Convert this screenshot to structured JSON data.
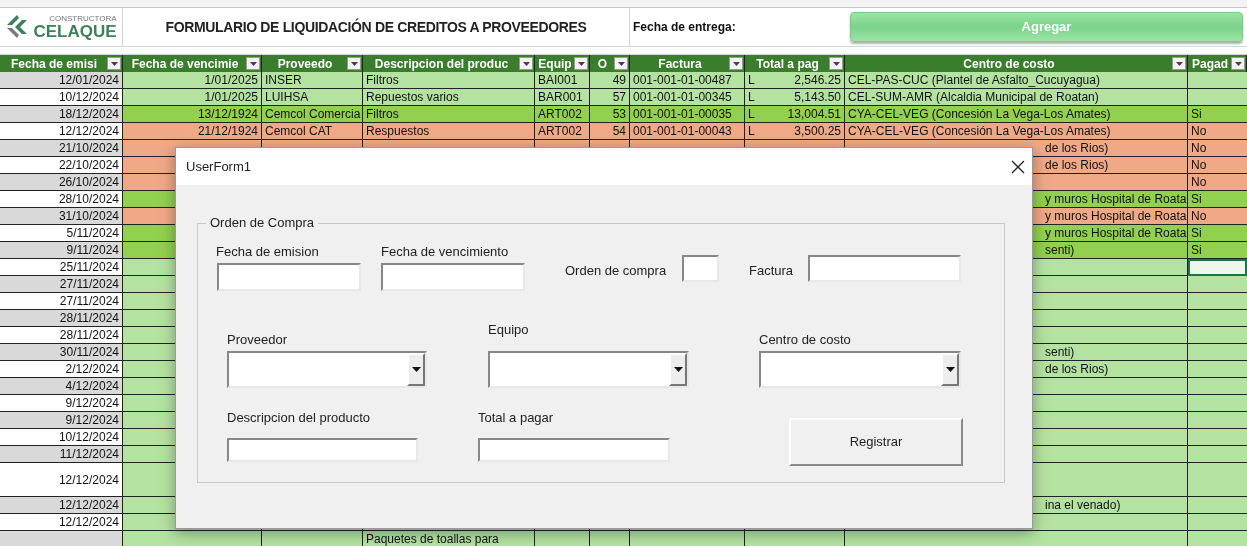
{
  "sheet": {
    "logo": {
      "tagline": "CONSTRUCTORA",
      "name": "CELAQUE"
    },
    "title": "FORMULARIO DE LIQUIDACIÓN DE CREDITOS A PROVEEDORES",
    "delivery_label": "Fecha de entrega:",
    "add_button": "Agregar",
    "columns": [
      "Fecha de emisi",
      "Fecha de vencimie",
      "Proveedo",
      "Descripcion del produc",
      "Equip",
      "O",
      "Factura",
      "Total a pag",
      "Centro de costo",
      "Pagad"
    ],
    "rows": [
      {
        "color": "#b4e3a1",
        "selected": false,
        "currency": "L",
        "cells": [
          "12/01/2024",
          "1/01/2025",
          "INSER",
          "Filtros",
          "BAI001",
          "49",
          "001-001-01-00487",
          "2,546.25",
          "CEL-PAS-CUC (Plantel de Asfalto_Cucuyagua)",
          null
        ]
      },
      {
        "color": "#b4e3a1",
        "selected": false,
        "currency": "L",
        "cells": [
          "10/12/2024",
          "1/01/2025",
          "LUIHSA",
          "Repuestos varios",
          "BAR001",
          "57",
          "001-001-01-00345",
          "5,143.50",
          "CEL-SUM-AMR (Alcaldia Municipal de Roatan)",
          null
        ]
      },
      {
        "color": "#92d050",
        "selected": false,
        "currency": "L",
        "cells": [
          "18/12/2024",
          "13/12/1924",
          "Cemcol Comercia",
          "Filtros",
          "ART002",
          "53",
          "001-001-01-00035",
          "13,004.51",
          "CYA-CEL-VEG (Concesión La Vega-Los Amates)",
          "Si"
        ]
      },
      {
        "color": "#f0a986",
        "selected": false,
        "currency": "L",
        "cells": [
          "12/12/2024",
          "21/12/1924",
          "Cemcol CAT",
          "Respuestos",
          "ART002",
          "54",
          "001-001-01-00043",
          "3,500.25",
          "CYA-CEL-VEG (Concesión La Vega-Los Amates)",
          "No"
        ]
      },
      {
        "color": "#f0a986",
        "selected": false,
        "cells": [
          "21/10/2024",
          null,
          null,
          null,
          null,
          null,
          null,
          null,
          "de los Rios)",
          "No"
        ]
      },
      {
        "color": "#f0a986",
        "selected": false,
        "cells": [
          "22/10/2024",
          null,
          null,
          null,
          null,
          null,
          null,
          null,
          "de los Rios)",
          "No"
        ]
      },
      {
        "color": "#f0a986",
        "selected": false,
        "cells": [
          "26/10/2024",
          null,
          null,
          null,
          null,
          null,
          null,
          null,
          null,
          "No"
        ]
      },
      {
        "color": "#92d050",
        "selected": false,
        "cells": [
          "28/10/2024",
          null,
          null,
          null,
          null,
          null,
          null,
          null,
          "y muros Hospital de Roata",
          "Si"
        ]
      },
      {
        "color": "#f0a986",
        "selected": false,
        "cells": [
          "31/10/2024",
          null,
          null,
          null,
          null,
          null,
          null,
          null,
          "y muros Hospital de Roata",
          "No"
        ]
      },
      {
        "color": "#92d050",
        "selected": false,
        "cells": [
          "5/11/2024",
          null,
          null,
          null,
          null,
          null,
          null,
          null,
          "y muros Hospital de Roata",
          "Si"
        ]
      },
      {
        "color": "#92d050",
        "selected": false,
        "cells": [
          "9/11/2024",
          null,
          null,
          null,
          null,
          null,
          null,
          null,
          "senti)",
          "Si"
        ]
      },
      {
        "color": "#b4e3a1",
        "selected": true,
        "cells": [
          "25/11/2024",
          null,
          null,
          null,
          null,
          null,
          null,
          null,
          null,
          null
        ]
      },
      {
        "color": "#b4e3a1",
        "selected": false,
        "cells": [
          "27/11/2024",
          null,
          null,
          null,
          null,
          null,
          null,
          null,
          null,
          null
        ]
      },
      {
        "color": "#b4e3a1",
        "selected": false,
        "cells": [
          "27/11/2024",
          null,
          null,
          null,
          null,
          null,
          null,
          null,
          null,
          null
        ]
      },
      {
        "color": "#b4e3a1",
        "selected": false,
        "cells": [
          "28/11/2024",
          null,
          null,
          null,
          null,
          null,
          null,
          null,
          null,
          null
        ]
      },
      {
        "color": "#b4e3a1",
        "selected": false,
        "cells": [
          "28/11/2024",
          null,
          null,
          null,
          null,
          null,
          null,
          null,
          null,
          null
        ]
      },
      {
        "color": "#b4e3a1",
        "selected": false,
        "cells": [
          "30/11/2024",
          null,
          null,
          null,
          null,
          null,
          null,
          null,
          "senti)",
          null
        ]
      },
      {
        "color": "#b4e3a1",
        "selected": false,
        "cells": [
          "2/12/2024",
          null,
          null,
          null,
          null,
          null,
          null,
          null,
          "de los Rios)",
          null
        ]
      },
      {
        "color": "#b4e3a1",
        "selected": false,
        "cells": [
          "4/12/2024",
          null,
          null,
          null,
          null,
          null,
          null,
          null,
          null,
          null
        ]
      },
      {
        "color": "#b4e3a1",
        "selected": false,
        "cells": [
          "9/12/2024",
          null,
          null,
          null,
          null,
          null,
          null,
          null,
          null,
          null
        ]
      },
      {
        "color": "#b4e3a1",
        "selected": false,
        "cells": [
          "9/12/2024",
          null,
          null,
          null,
          null,
          null,
          null,
          null,
          null,
          null
        ]
      },
      {
        "color": "#b4e3a1",
        "selected": false,
        "cells": [
          "10/12/2024",
          null,
          null,
          null,
          null,
          null,
          null,
          null,
          null,
          null
        ]
      },
      {
        "color": "#b4e3a1",
        "selected": false,
        "cells": [
          "11/12/2024",
          null,
          null,
          null,
          null,
          null,
          null,
          null,
          null,
          null
        ]
      },
      {
        "color": "#b4e3a1",
        "selected": false,
        "cells": [
          "12/12/2024",
          null,
          null,
          null,
          null,
          null,
          null,
          null,
          null,
          null
        ]
      },
      {
        "color": "#b4e3a1",
        "selected": false,
        "cells": [
          "12/12/2024",
          null,
          null,
          null,
          null,
          null,
          null,
          null,
          "ina el venado)",
          null
        ]
      },
      {
        "color": "#b4e3a1",
        "selected": false,
        "cells": [
          "12/12/2024",
          null,
          null,
          null,
          null,
          null,
          null,
          null,
          null,
          null
        ]
      },
      {
        "color": "#b4e3a1",
        "selected": false,
        "cells": [
          null,
          null,
          null,
          "Paquetes de toallas para",
          null,
          null,
          null,
          null,
          null,
          null
        ]
      }
    ]
  },
  "dialog": {
    "title": "UserForm1",
    "frame_title": "Orden de Compra",
    "button": "Registrar",
    "fields": [
      {
        "label": "Fecha de emision",
        "kind": "text"
      },
      {
        "label": "Fecha de vencimiento",
        "kind": "text"
      },
      {
        "label": "Orden de compra",
        "kind": "text"
      },
      {
        "label": "Factura",
        "kind": "text"
      },
      {
        "label": "Proveedor",
        "kind": "combo"
      },
      {
        "label": "Equipo",
        "kind": "combo"
      },
      {
        "label": "Centro de costo",
        "kind": "combo"
      },
      {
        "label": "Descripcion del producto",
        "kind": "text"
      },
      {
        "label": "Total a pagar",
        "kind": "text"
      }
    ]
  }
}
